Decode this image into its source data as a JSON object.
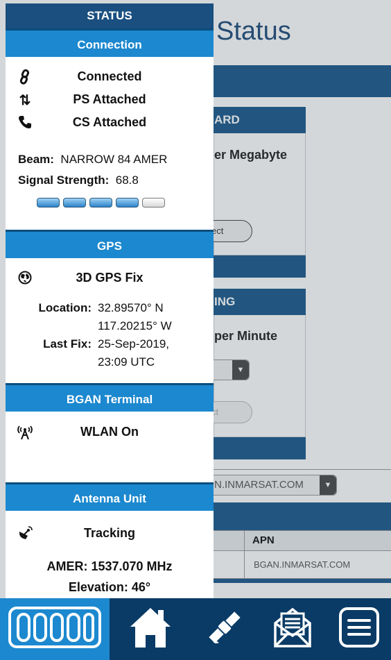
{
  "background": {
    "title_fragment": "Status",
    "card1_header": "ARD",
    "card1_label": "er Megabyte",
    "card1_button": "ect",
    "card2_header": "ING",
    "card2_label": "per Minute",
    "card2_button": "ct",
    "apn_select_value": "N.INMARSAT.COM",
    "table_header_apn": "APN",
    "table_cell_apn": "BGAN.INMARSAT.COM"
  },
  "drawer": {
    "title": "STATUS",
    "connection": {
      "header": "Connection",
      "items": [
        {
          "icon": "link-icon",
          "label": "Connected"
        },
        {
          "icon": "up-down-arrows-icon",
          "label": "PS Attached"
        },
        {
          "icon": "phone-icon",
          "label": "CS Attached"
        }
      ],
      "beam_label": "Beam:",
      "beam_value": "NARROW 84 AMER",
      "signal_label": "Signal Strength:",
      "signal_value": "68.8",
      "signal_bars_lit": 4,
      "signal_bars_total": 5
    },
    "gps": {
      "header": "GPS",
      "status_icon": "globe-icon",
      "status": "3D GPS Fix",
      "location_label": "Location:",
      "location_lat": "32.89570° N",
      "location_lon": "117.20215° W",
      "last_fix_label": "Last Fix:",
      "last_fix_date": "25-Sep-2019,",
      "last_fix_time": "23:09 UTC"
    },
    "terminal": {
      "header": "BGAN Terminal",
      "status_icon": "wifi-antenna-icon",
      "status": "WLAN On"
    },
    "antenna": {
      "header": "Antenna Unit",
      "status_icon": "satellite-dish-icon",
      "status": "Tracking",
      "frequency": "AMER: 1537.070 MHz",
      "elevation": "Elevation: 46°"
    }
  },
  "bottom_nav": {
    "items": [
      {
        "name": "status",
        "icon": "signal-bars-icon",
        "active": true
      },
      {
        "name": "home",
        "icon": "home-icon",
        "active": false
      },
      {
        "name": "satellite",
        "icon": "satellite-icon",
        "active": false
      },
      {
        "name": "messages",
        "icon": "envelope-icon",
        "active": false
      },
      {
        "name": "menu",
        "icon": "menu-icon",
        "active": false
      }
    ]
  },
  "colors": {
    "drawer_title_bg": "#1a4f80",
    "section_header_bg": "#1c88cf",
    "nav_bg": "#0a3b66",
    "nav_active_bg": "#1c88cf",
    "signal_lit": "#2b82c8"
  }
}
